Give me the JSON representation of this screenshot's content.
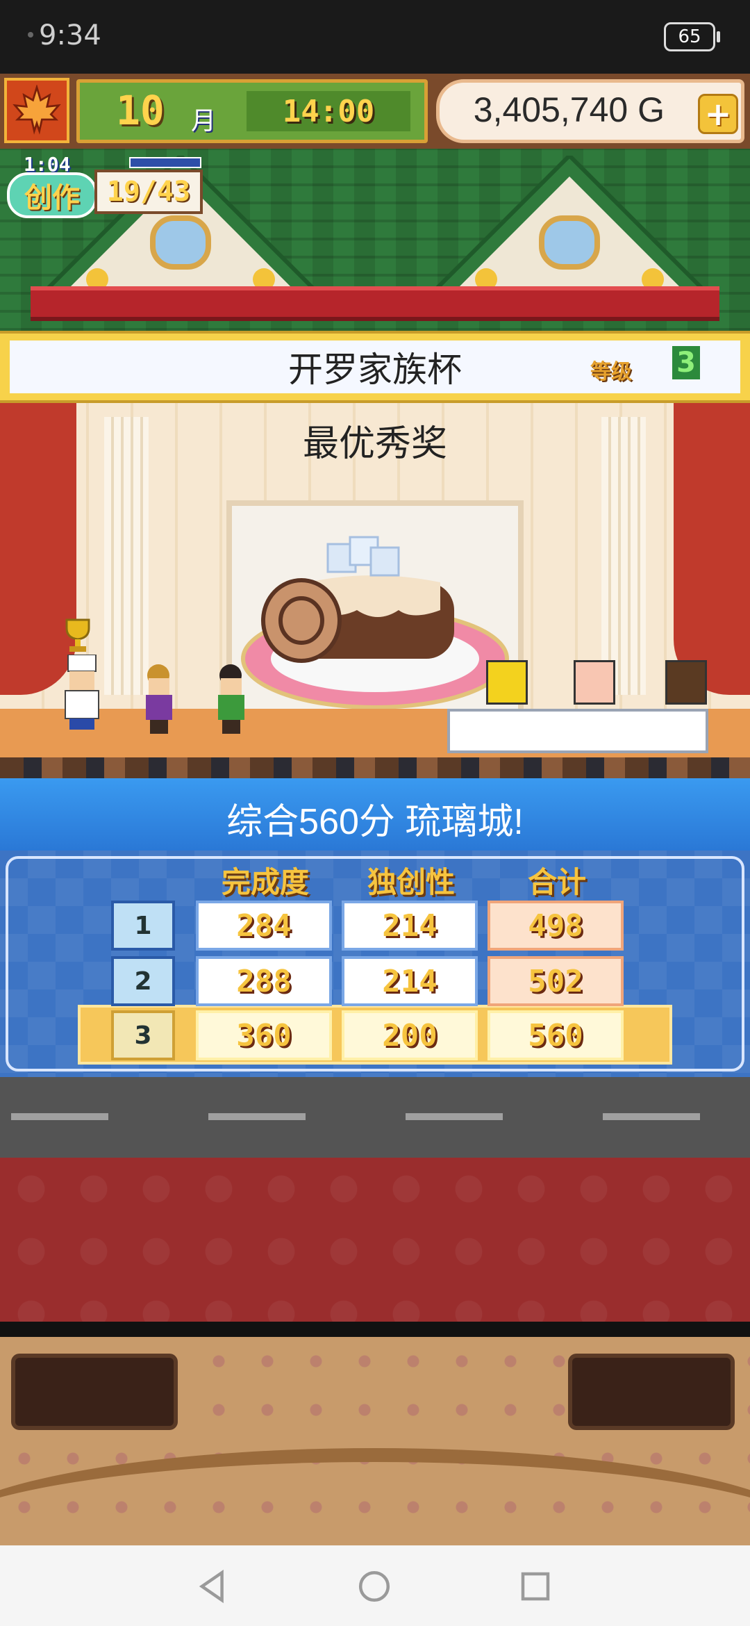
{
  "status_bar": {
    "time": "9:34",
    "battery": "65"
  },
  "hud": {
    "month": "10",
    "month_label": "月",
    "clock": "14:00",
    "money": "3,405,740 G",
    "plus": "+"
  },
  "creation": {
    "timer": "1:04",
    "label": "创作",
    "count": "19/43"
  },
  "contest": {
    "title": "开罗家族杯",
    "rank_label": "等级",
    "rank_value": "3"
  },
  "scene": {
    "award": "最优秀奖"
  },
  "results": {
    "summary": "综合560分 琉璃城!",
    "headers": [
      "完成度",
      "独创性",
      "合计"
    ],
    "rows": [
      {
        "rank": "1",
        "completion": "284",
        "originality": "214",
        "total": "498"
      },
      {
        "rank": "2",
        "completion": "288",
        "originality": "214",
        "total": "502"
      },
      {
        "rank": "3",
        "completion": "360",
        "originality": "200",
        "total": "560"
      }
    ]
  },
  "icons": [
    "maple-leaf-icon",
    "plus-icon",
    "trophy-icon",
    "back-icon",
    "home-icon",
    "recents-icon"
  ],
  "colors": {
    "accent": "#f6c43f",
    "panel_blue": "#3d74c4",
    "hud_green": "#6aa43b"
  }
}
